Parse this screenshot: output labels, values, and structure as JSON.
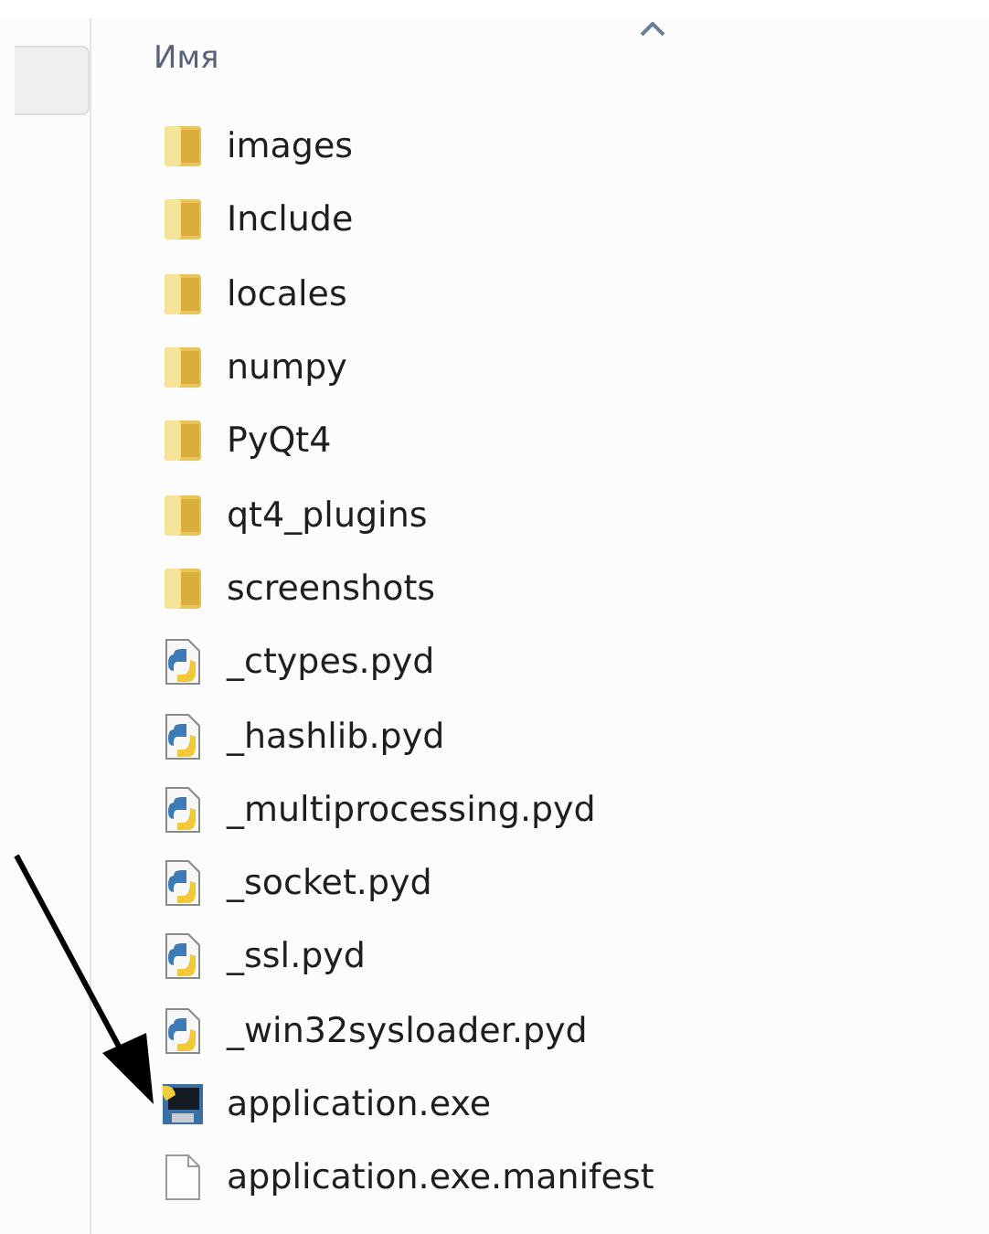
{
  "columns": [
    {
      "label": "Имя",
      "sorted": true
    }
  ],
  "files": [
    {
      "name": "images",
      "kind": "folder"
    },
    {
      "name": "Include",
      "kind": "folder"
    },
    {
      "name": "locales",
      "kind": "folder"
    },
    {
      "name": "numpy",
      "kind": "folder"
    },
    {
      "name": "PyQt4",
      "kind": "folder"
    },
    {
      "name": "qt4_plugins",
      "kind": "folder"
    },
    {
      "name": "screenshots",
      "kind": "folder"
    },
    {
      "name": "_ctypes.pyd",
      "kind": "pyd"
    },
    {
      "name": "_hashlib.pyd",
      "kind": "pyd"
    },
    {
      "name": "_multiprocessing.pyd",
      "kind": "pyd"
    },
    {
      "name": "_socket.pyd",
      "kind": "pyd"
    },
    {
      "name": "_ssl.pyd",
      "kind": "pyd"
    },
    {
      "name": "_win32sysloader.pyd",
      "kind": "pyd"
    },
    {
      "name": "application.exe",
      "kind": "exe"
    },
    {
      "name": "application.exe.manifest",
      "kind": "file"
    }
  ]
}
